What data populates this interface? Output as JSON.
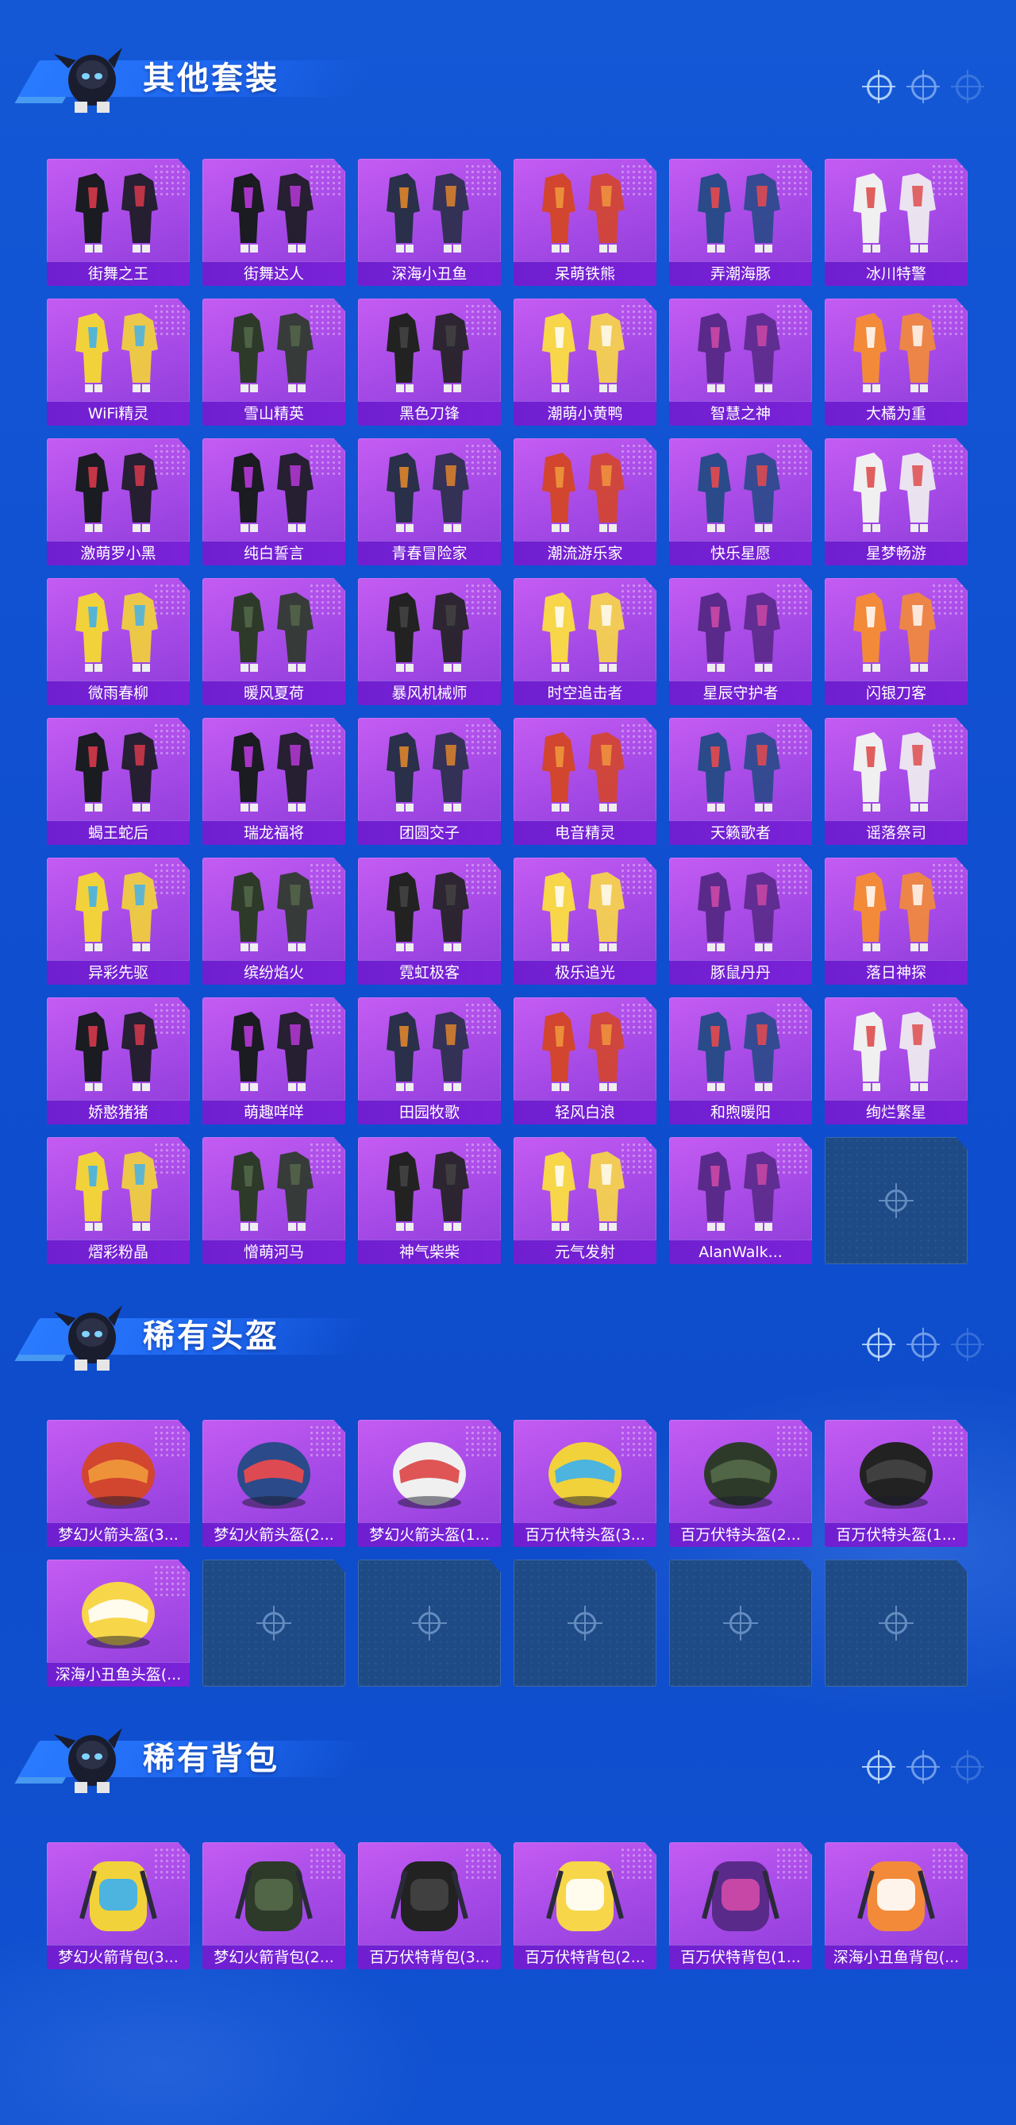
{
  "sections": [
    {
      "title": "其他套装",
      "kind": "outfit",
      "items": [
        "街舞之王",
        "街舞达人",
        "深海小丑鱼",
        "呆萌铁熊",
        "弄潮海豚",
        "冰川特警",
        "WiFi精灵",
        "雪山精英",
        "黑色刀锋",
        "潮萌小黄鸭",
        "智慧之神",
        "大橘为重",
        "激萌罗小黑",
        "纯白誓言",
        "青春冒险家",
        "潮流游乐家",
        "快乐星愿",
        "星梦畅游",
        "微雨春柳",
        "暖风夏荷",
        "暴风机械师",
        "时空追击者",
        "星辰守护者",
        "闪银刀客",
        "蝎王蛇后",
        "瑞龙福将",
        "团圆交子",
        "电音精灵",
        "天籁歌者",
        "谣落祭司",
        "异彩先驱",
        "缤纷焰火",
        "霓虹极客",
        "极乐追光",
        "豚鼠丹丹",
        "落日神探",
        "娇憨猪猪",
        "萌趣咩咩",
        "田园牧歌",
        "轻风白浪",
        "和煦暖阳",
        "绚烂繁星",
        "熠彩粉晶",
        "憎萌河马",
        "神气柴柴",
        "元气发射",
        "AlanWalk..."
      ],
      "empty_slots": 1
    },
    {
      "title": "稀有头盔",
      "kind": "helmet",
      "items": [
        "梦幻火箭头盔(3...",
        "梦幻火箭头盔(2...",
        "梦幻火箭头盔(1...",
        "百万伏特头盔(3...",
        "百万伏特头盔(2...",
        "百万伏特头盔(1...",
        "深海小丑鱼头盔(..."
      ],
      "empty_slots": 5
    },
    {
      "title": "稀有背包",
      "kind": "backpack",
      "items": [
        "梦幻火箭背包(3...",
        "梦幻火箭背包(2...",
        "百万伏特背包(3...",
        "百万伏特背包(2...",
        "百万伏特背包(1...",
        "深海小丑鱼背包(..."
      ],
      "empty_slots": 0
    }
  ],
  "colors": {
    "card_purple": "#a449e6",
    "label_purple": "#7a22d8",
    "page_blue": "#0f4fd0",
    "empty_slot": "#1e4a86"
  },
  "icons": [
    "crosshair-icon",
    "mascot-icon"
  ]
}
